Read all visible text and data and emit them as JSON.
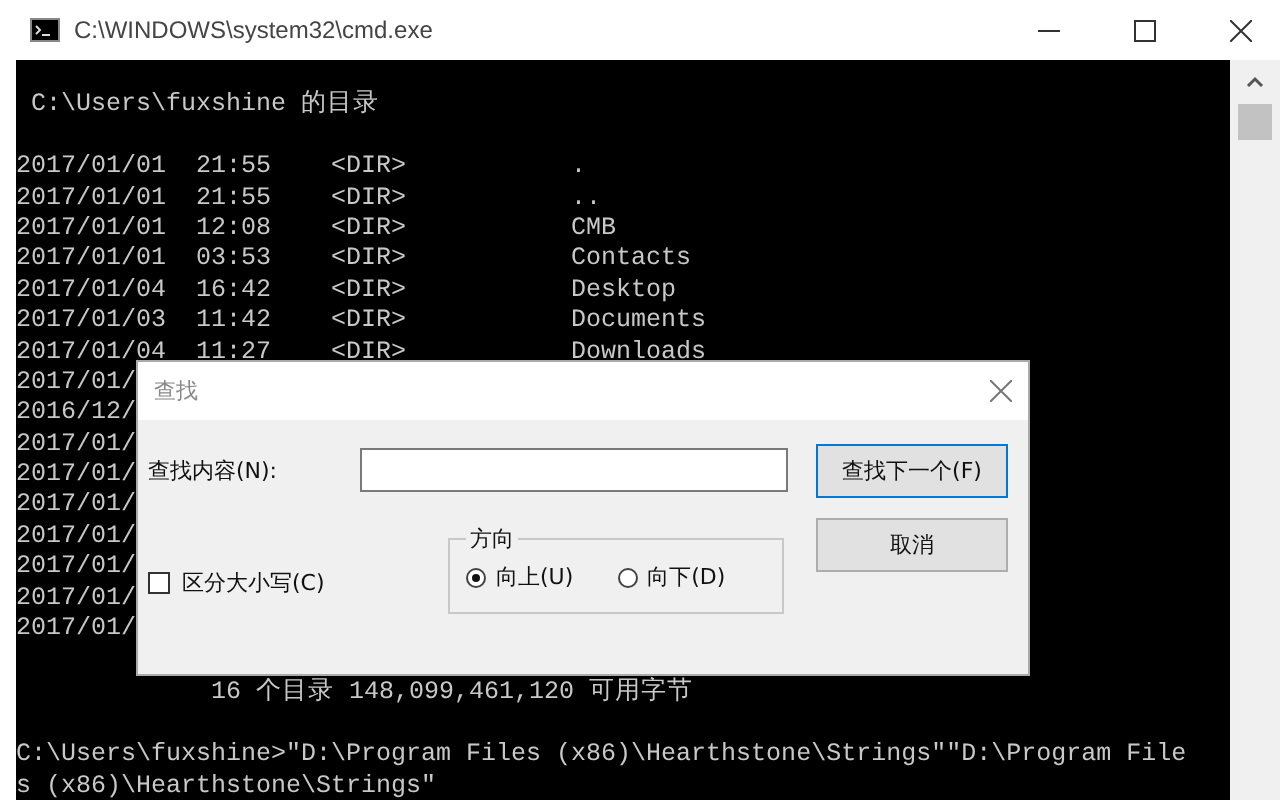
{
  "window": {
    "title": "C:\\WINDOWS\\system32\\cmd.exe"
  },
  "console": {
    "heading": "C:\\Users\\fuxshine 的目录",
    "rows": [
      {
        "date": "2017/01/01",
        "time": "21:55",
        "type": "<DIR>",
        "name": "."
      },
      {
        "date": "2017/01/01",
        "time": "21:55",
        "type": "<DIR>",
        "name": ".."
      },
      {
        "date": "2017/01/01",
        "time": "12:08",
        "type": "<DIR>",
        "name": "CMB"
      },
      {
        "date": "2017/01/01",
        "time": "03:53",
        "type": "<DIR>",
        "name": "Contacts"
      },
      {
        "date": "2017/01/04",
        "time": "16:42",
        "type": "<DIR>",
        "name": "Desktop"
      },
      {
        "date": "2017/01/03",
        "time": "11:42",
        "type": "<DIR>",
        "name": "Documents"
      },
      {
        "date": "2017/01/04",
        "time": "11:27",
        "type": "<DIR>",
        "name": "Downloads"
      },
      {
        "date": "2017/01/"
      },
      {
        "date": "2016/12/"
      },
      {
        "date": "2017/01/"
      },
      {
        "date": "2017/01/"
      },
      {
        "date": "2017/01/"
      },
      {
        "date": "2017/01/"
      },
      {
        "date": "2017/01/"
      },
      {
        "date": "2017/01/"
      },
      {
        "date": "2017/01/"
      }
    ],
    "summary": "16 个目录 148,099,461,120 可用字节",
    "command_lines": [
      "C:\\Users\\fuxshine>\"D:\\Program Files (x86)\\Hearthstone\\Strings\"\"D:\\Program File",
      "s (x86)\\Hearthstone\\Strings\""
    ]
  },
  "find_dialog": {
    "title": "查找",
    "find_label": "查找内容(N):",
    "find_next_button": "查找下一个(F)",
    "cancel_button": "取消",
    "direction_group": "方向",
    "directions": [
      {
        "label": "向上(U)",
        "selected": true
      },
      {
        "label": "向下(D)",
        "selected": false
      }
    ],
    "match_case": {
      "label": "区分大小写(C)",
      "checked": false
    }
  }
}
